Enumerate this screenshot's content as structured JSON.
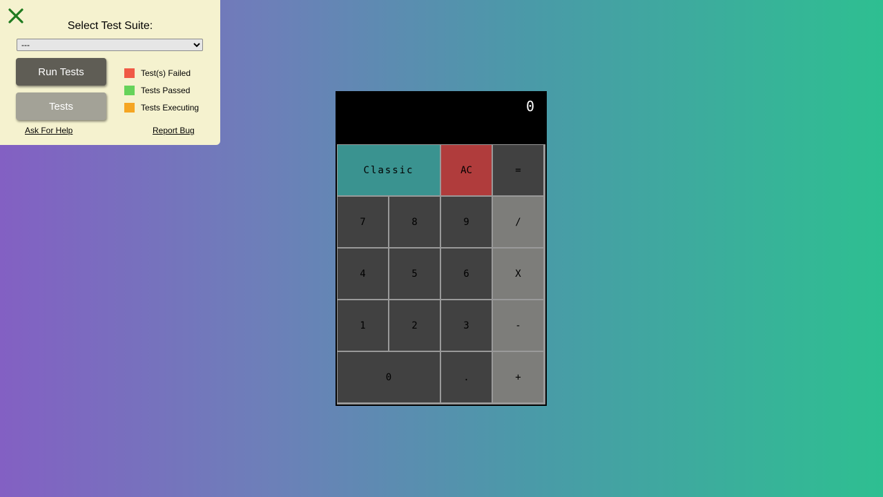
{
  "panel": {
    "suite_label": "Select Test Suite:",
    "suite_selected": "---",
    "run_label": "Run Tests",
    "tests_label": "Tests",
    "legend": [
      {
        "label": "Test(s) Failed",
        "color": "#f05a46"
      },
      {
        "label": "Tests Passed",
        "color": "#66d35a"
      },
      {
        "label": "Tests Executing",
        "color": "#f5a623"
      }
    ],
    "help_link": "Ask For Help",
    "bug_link": "Report Bug",
    "close_icon": "close-x-icon",
    "close_color": "#1f7a1f"
  },
  "calculator": {
    "display_value": "0",
    "keys": {
      "mode": "Classic",
      "clear": "AC",
      "equals": "=",
      "k7": "7",
      "k8": "8",
      "k9": "9",
      "divide": "/",
      "k4": "4",
      "k5": "5",
      "k6": "6",
      "multiply": "X",
      "k1": "1",
      "k2": "2",
      "k3": "3",
      "subtract": "-",
      "k0": "0",
      "decimal": ".",
      "add": "+"
    }
  }
}
